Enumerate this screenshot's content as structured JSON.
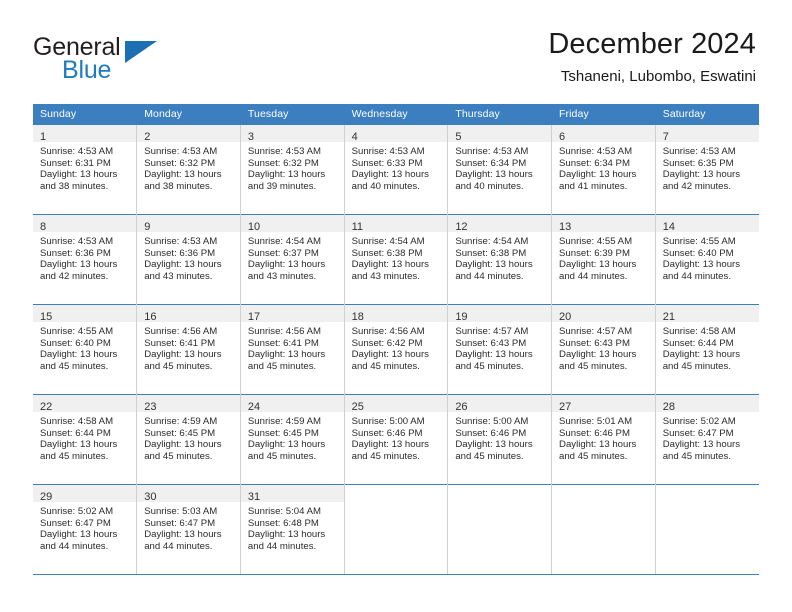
{
  "brand": {
    "name_top": "General",
    "name_bottom": "Blue",
    "triangle_icon": "triangle-icon",
    "accent_color": "#1b6fb5"
  },
  "header": {
    "title": "December 2024",
    "subtitle": "Tshaneni, Lubombo, Eswatini"
  },
  "calendar": {
    "header_bg": "#3c7fc1",
    "daynum_bg": "#f0f0f0",
    "weekday_headers": [
      "Sunday",
      "Monday",
      "Tuesday",
      "Wednesday",
      "Thursday",
      "Friday",
      "Saturday"
    ],
    "weeks": [
      [
        {
          "day": "1",
          "lines": [
            "Sunrise: 4:53 AM",
            "Sunset: 6:31 PM",
            "Daylight: 13 hours",
            "and 38 minutes."
          ]
        },
        {
          "day": "2",
          "lines": [
            "Sunrise: 4:53 AM",
            "Sunset: 6:32 PM",
            "Daylight: 13 hours",
            "and 38 minutes."
          ]
        },
        {
          "day": "3",
          "lines": [
            "Sunrise: 4:53 AM",
            "Sunset: 6:32 PM",
            "Daylight: 13 hours",
            "and 39 minutes."
          ]
        },
        {
          "day": "4",
          "lines": [
            "Sunrise: 4:53 AM",
            "Sunset: 6:33 PM",
            "Daylight: 13 hours",
            "and 40 minutes."
          ]
        },
        {
          "day": "5",
          "lines": [
            "Sunrise: 4:53 AM",
            "Sunset: 6:34 PM",
            "Daylight: 13 hours",
            "and 40 minutes."
          ]
        },
        {
          "day": "6",
          "lines": [
            "Sunrise: 4:53 AM",
            "Sunset: 6:34 PM",
            "Daylight: 13 hours",
            "and 41 minutes."
          ]
        },
        {
          "day": "7",
          "lines": [
            "Sunrise: 4:53 AM",
            "Sunset: 6:35 PM",
            "Daylight: 13 hours",
            "and 42 minutes."
          ]
        }
      ],
      [
        {
          "day": "8",
          "lines": [
            "Sunrise: 4:53 AM",
            "Sunset: 6:36 PM",
            "Daylight: 13 hours",
            "and 42 minutes."
          ]
        },
        {
          "day": "9",
          "lines": [
            "Sunrise: 4:53 AM",
            "Sunset: 6:36 PM",
            "Daylight: 13 hours",
            "and 43 minutes."
          ]
        },
        {
          "day": "10",
          "lines": [
            "Sunrise: 4:54 AM",
            "Sunset: 6:37 PM",
            "Daylight: 13 hours",
            "and 43 minutes."
          ]
        },
        {
          "day": "11",
          "lines": [
            "Sunrise: 4:54 AM",
            "Sunset: 6:38 PM",
            "Daylight: 13 hours",
            "and 43 minutes."
          ]
        },
        {
          "day": "12",
          "lines": [
            "Sunrise: 4:54 AM",
            "Sunset: 6:38 PM",
            "Daylight: 13 hours",
            "and 44 minutes."
          ]
        },
        {
          "day": "13",
          "lines": [
            "Sunrise: 4:55 AM",
            "Sunset: 6:39 PM",
            "Daylight: 13 hours",
            "and 44 minutes."
          ]
        },
        {
          "day": "14",
          "lines": [
            "Sunrise: 4:55 AM",
            "Sunset: 6:40 PM",
            "Daylight: 13 hours",
            "and 44 minutes."
          ]
        }
      ],
      [
        {
          "day": "15",
          "lines": [
            "Sunrise: 4:55 AM",
            "Sunset: 6:40 PM",
            "Daylight: 13 hours",
            "and 45 minutes."
          ]
        },
        {
          "day": "16",
          "lines": [
            "Sunrise: 4:56 AM",
            "Sunset: 6:41 PM",
            "Daylight: 13 hours",
            "and 45 minutes."
          ]
        },
        {
          "day": "17",
          "lines": [
            "Sunrise: 4:56 AM",
            "Sunset: 6:41 PM",
            "Daylight: 13 hours",
            "and 45 minutes."
          ]
        },
        {
          "day": "18",
          "lines": [
            "Sunrise: 4:56 AM",
            "Sunset: 6:42 PM",
            "Daylight: 13 hours",
            "and 45 minutes."
          ]
        },
        {
          "day": "19",
          "lines": [
            "Sunrise: 4:57 AM",
            "Sunset: 6:43 PM",
            "Daylight: 13 hours",
            "and 45 minutes."
          ]
        },
        {
          "day": "20",
          "lines": [
            "Sunrise: 4:57 AM",
            "Sunset: 6:43 PM",
            "Daylight: 13 hours",
            "and 45 minutes."
          ]
        },
        {
          "day": "21",
          "lines": [
            "Sunrise: 4:58 AM",
            "Sunset: 6:44 PM",
            "Daylight: 13 hours",
            "and 45 minutes."
          ]
        }
      ],
      [
        {
          "day": "22",
          "lines": [
            "Sunrise: 4:58 AM",
            "Sunset: 6:44 PM",
            "Daylight: 13 hours",
            "and 45 minutes."
          ]
        },
        {
          "day": "23",
          "lines": [
            "Sunrise: 4:59 AM",
            "Sunset: 6:45 PM",
            "Daylight: 13 hours",
            "and 45 minutes."
          ]
        },
        {
          "day": "24",
          "lines": [
            "Sunrise: 4:59 AM",
            "Sunset: 6:45 PM",
            "Daylight: 13 hours",
            "and 45 minutes."
          ]
        },
        {
          "day": "25",
          "lines": [
            "Sunrise: 5:00 AM",
            "Sunset: 6:46 PM",
            "Daylight: 13 hours",
            "and 45 minutes."
          ]
        },
        {
          "day": "26",
          "lines": [
            "Sunrise: 5:00 AM",
            "Sunset: 6:46 PM",
            "Daylight: 13 hours",
            "and 45 minutes."
          ]
        },
        {
          "day": "27",
          "lines": [
            "Sunrise: 5:01 AM",
            "Sunset: 6:46 PM",
            "Daylight: 13 hours",
            "and 45 minutes."
          ]
        },
        {
          "day": "28",
          "lines": [
            "Sunrise: 5:02 AM",
            "Sunset: 6:47 PM",
            "Daylight: 13 hours",
            "and 45 minutes."
          ]
        }
      ],
      [
        {
          "day": "29",
          "lines": [
            "Sunrise: 5:02 AM",
            "Sunset: 6:47 PM",
            "Daylight: 13 hours",
            "and 44 minutes."
          ]
        },
        {
          "day": "30",
          "lines": [
            "Sunrise: 5:03 AM",
            "Sunset: 6:47 PM",
            "Daylight: 13 hours",
            "and 44 minutes."
          ]
        },
        {
          "day": "31",
          "lines": [
            "Sunrise: 5:04 AM",
            "Sunset: 6:48 PM",
            "Daylight: 13 hours",
            "and 44 minutes."
          ]
        },
        {
          "day": "",
          "lines": []
        },
        {
          "day": "",
          "lines": []
        },
        {
          "day": "",
          "lines": []
        },
        {
          "day": "",
          "lines": []
        }
      ]
    ]
  }
}
